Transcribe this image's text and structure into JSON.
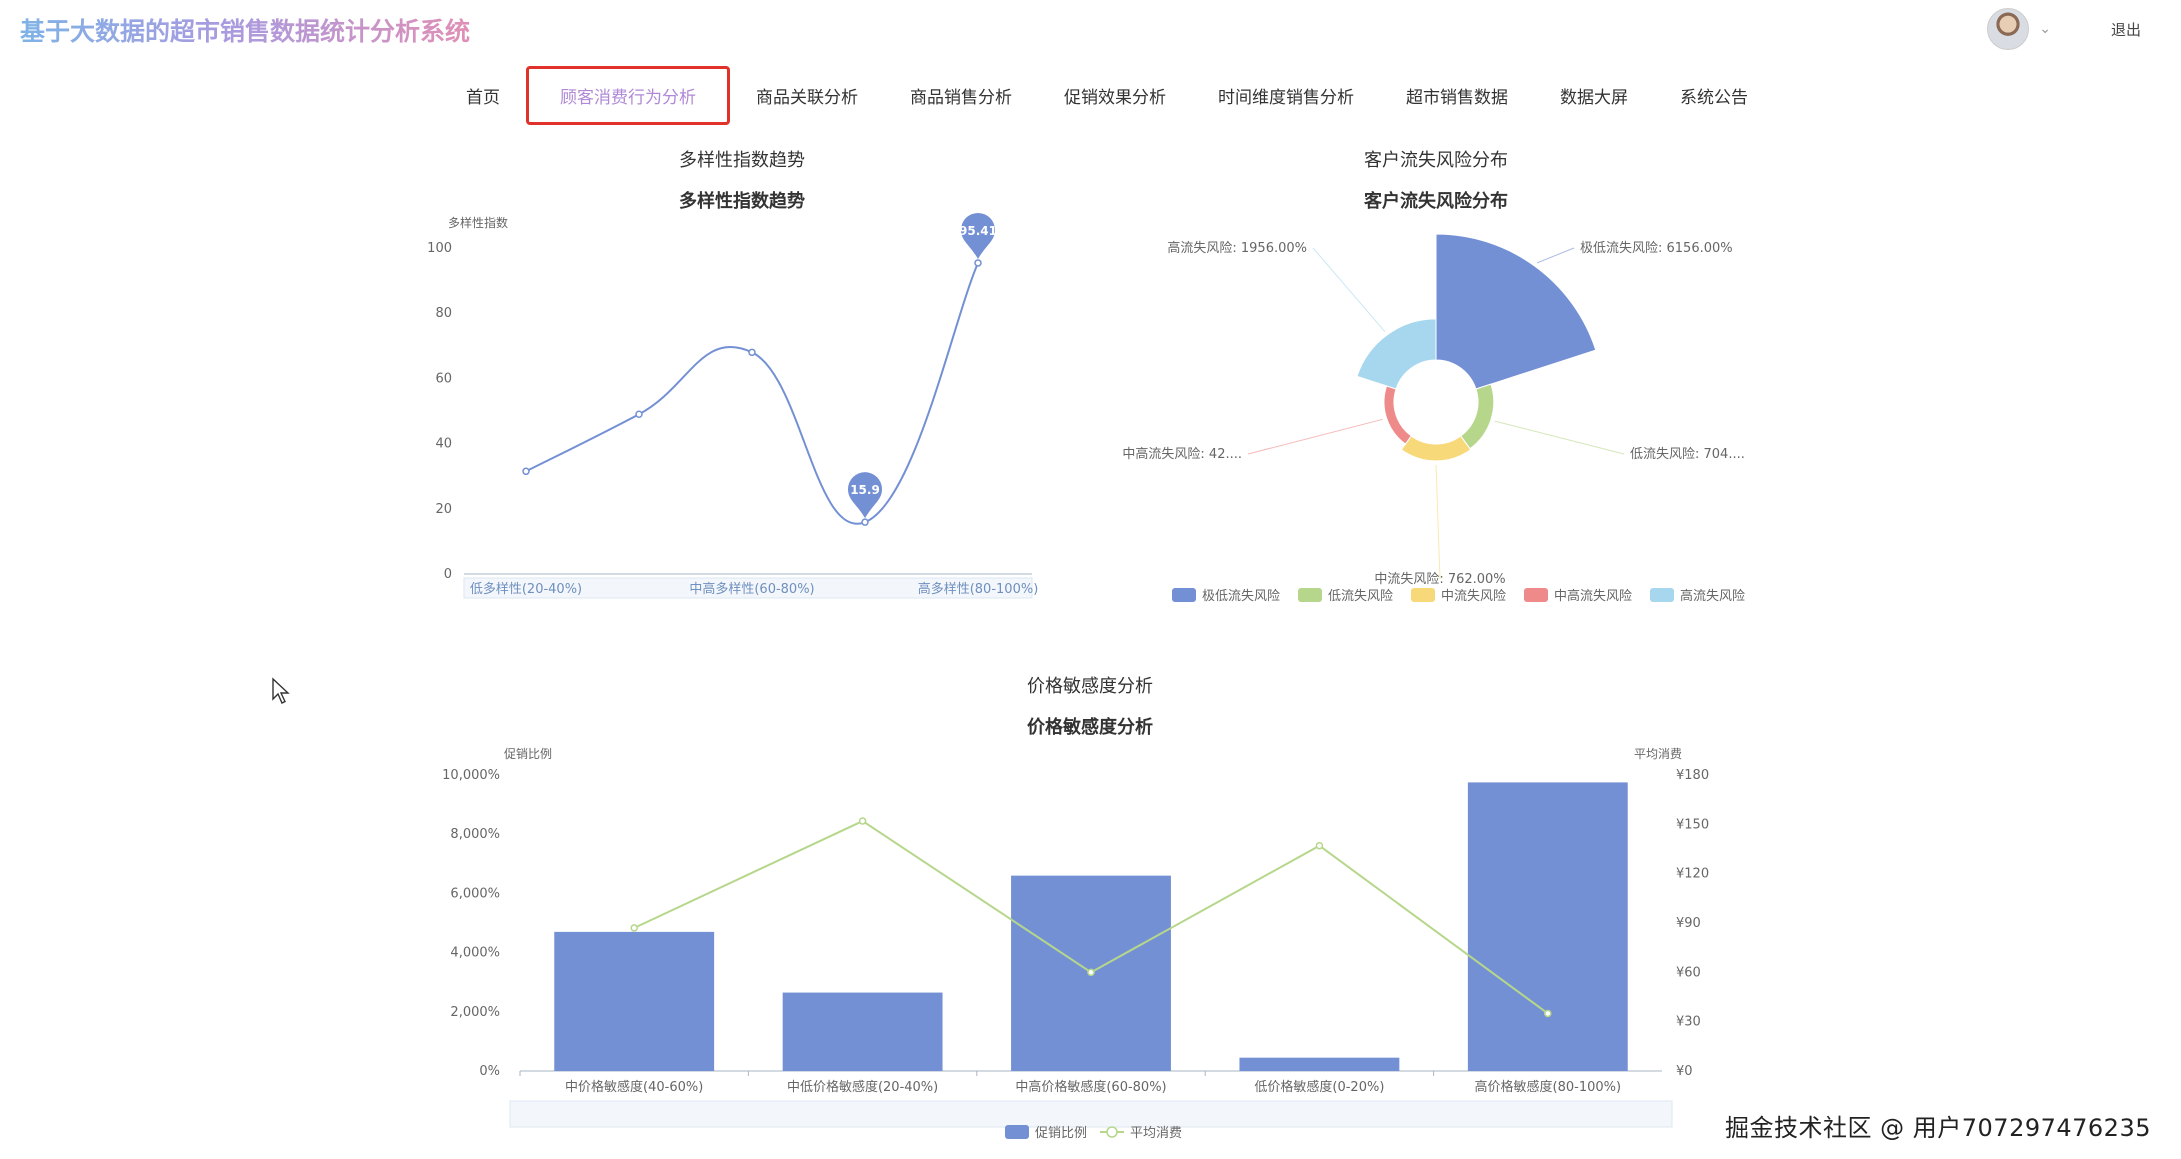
{
  "app": {
    "title": "基于大数据的超市销售数据统计分析系统"
  },
  "user": {
    "logout_label": "退出"
  },
  "nav": {
    "items": [
      "首页",
      "顾客消费行为分析",
      "商品关联分析",
      "商品销售分析",
      "促销效果分析",
      "时间维度销售分析",
      "超市销售数据",
      "数据大屏",
      "系统公告"
    ],
    "active_index": 1
  },
  "colors": {
    "primary": "#7490d4",
    "green": "#b6d78b",
    "yellow": "#f8d97a",
    "red": "#ee8a8a",
    "lightblue": "#a6d7ee",
    "active_nav_text": "#b089d6",
    "active_nav_border": "#e0322b"
  },
  "chart_data": [
    {
      "type": "line",
      "panel_title": "多样性指数趋势",
      "title": "多样性指数趋势",
      "ylabel": "多样性指数",
      "ylim": [
        0,
        100
      ],
      "yticks": [
        0,
        20,
        40,
        60,
        80,
        100
      ],
      "x": [
        0,
        1,
        2,
        3,
        4
      ],
      "x_tick_labels": [
        {
          "at": 0,
          "label": "低多样性(20-40%)"
        },
        {
          "at": 2,
          "label": "中高多样性(60-80%)"
        },
        {
          "at": 4,
          "label": "高多样性(80-100%)"
        }
      ],
      "series": [
        {
          "values": [
            31.5,
            49,
            68,
            15.9,
            95.41
          ]
        }
      ],
      "markers": [
        {
          "label": "15.9",
          "index": 3
        },
        {
          "label": "95.41",
          "index": 4
        }
      ]
    },
    {
      "type": "pie",
      "subtype": "nightingale-rose",
      "panel_title": "客户流失风险分布",
      "title": "客户流失风险分布",
      "slices": [
        {
          "name": "极低流失风险",
          "value": 61.56,
          "label": "极低流失风险: 6156.00%",
          "color": "#7490d4"
        },
        {
          "name": "低流失风险",
          "value": 7.04,
          "label": "低流失风险: 704....",
          "color": "#b6d78b"
        },
        {
          "name": "中流失风险",
          "value": 7.62,
          "label": "中流失风险: 762.00%",
          "color": "#f8d97a"
        },
        {
          "name": "中高流失风险",
          "value": 4.2,
          "label": "中高流失风险: 42....",
          "color": "#ee8a8a"
        },
        {
          "name": "高流失风险",
          "value": 19.56,
          "label": "高流失风险: 1956.00%",
          "color": "#a6d7ee"
        }
      ],
      "legend": [
        "极低流失风险",
        "低流失风险",
        "中流失风险",
        "中高流失风险",
        "高流失风险"
      ],
      "legend_position": "bottom"
    },
    {
      "type": "bar",
      "panel_title": "价格敏感度分析",
      "title": "价格敏感度分析",
      "categories": [
        "中价格敏感度(40-60%)",
        "中低价格敏感度(20-40%)",
        "中高价格敏感度(60-80%)",
        "低价格敏感度(0-20%)",
        "高价格敏感度(80-100%)"
      ],
      "ylabel": "促销比例",
      "ylim": [
        0,
        10000
      ],
      "yticks": [
        "0%",
        "2,000%",
        "4,000%",
        "6,000%",
        "8,000%",
        "10,000%"
      ],
      "y2label": "平均消费",
      "y2lim": [
        0,
        180
      ],
      "y2ticks": [
        "¥0",
        "¥30",
        "¥60",
        "¥90",
        "¥120",
        "¥150",
        "¥180"
      ],
      "series": [
        {
          "name": "促销比例",
          "type": "bar",
          "values": [
            4700,
            2650,
            6600,
            450,
            9750
          ]
        },
        {
          "name": "平均消费",
          "type": "line",
          "axis": "right",
          "values": [
            87,
            152,
            60,
            137,
            35
          ]
        }
      ],
      "legend_position": "bottom"
    }
  ],
  "watermark": "掘金技术社区 @ 用户707297476235"
}
